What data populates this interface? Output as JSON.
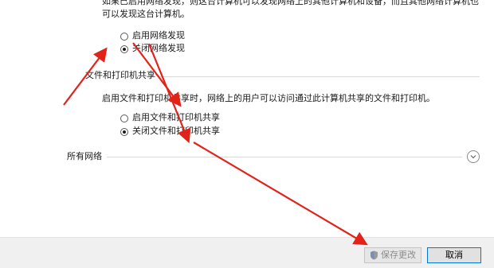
{
  "network_discovery": {
    "description_lines": [
      "如果已启用网络发现，则这台计算机可以发现网络上的其他计算机和设备，而且其他网络计算机也",
      "可以发现这台计算机。"
    ],
    "options": [
      {
        "label": "启用网络发现",
        "checked": false
      },
      {
        "label": "关闭网络发现",
        "checked": true
      }
    ]
  },
  "file_printer_sharing": {
    "title": "文件和打印机共享",
    "description": "启用文件和打印机共享时，网络上的用户可以访问通过此计算机共享的文件和打印机。",
    "options": [
      {
        "label": "启用文件和打印机共享",
        "checked": false
      },
      {
        "label": "关闭文件和打印机共享",
        "checked": true
      }
    ]
  },
  "all_networks": {
    "title": "所有网络",
    "expand_icon": "chevron-down-icon"
  },
  "footer": {
    "save_label": "保存更改",
    "cancel_label": "取消",
    "save_icon": "shield-icon"
  },
  "colors": {
    "annotation_arrow": "#e2231a",
    "primary_border": "#0078d7"
  }
}
